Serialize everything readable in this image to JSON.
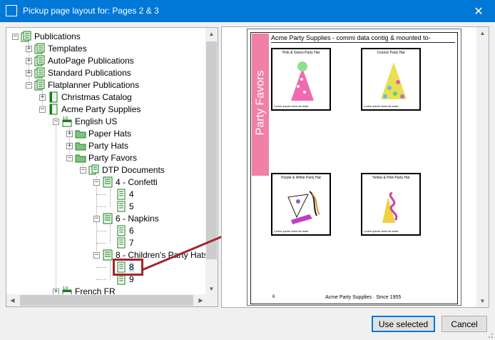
{
  "window": {
    "title": "Pickup page layout for: Pages 2 & 3",
    "close_glyph": "✕"
  },
  "tree": {
    "nodes": [
      {
        "label": "Publications",
        "level": 0,
        "expander": "−",
        "icon": "publications-icon"
      },
      {
        "label": "Templates",
        "level": 1,
        "expander": "+",
        "icon": "publications-icon"
      },
      {
        "label": "AutoPage Publications",
        "level": 1,
        "expander": "+",
        "icon": "publications-icon"
      },
      {
        "label": "Standard Publications",
        "level": 1,
        "expander": "+",
        "icon": "publications-icon"
      },
      {
        "label": "Flatplanner Publications",
        "level": 1,
        "expander": "−",
        "icon": "publications-icon"
      },
      {
        "label": "Christmas Catalog",
        "level": 2,
        "expander": "+",
        "icon": "publication-icon"
      },
      {
        "label": "Acme Party Supplies",
        "level": 2,
        "expander": "−",
        "icon": "publication-icon"
      },
      {
        "label": "English US",
        "level": 3,
        "expander": "−",
        "icon": "edition-icon"
      },
      {
        "label": "Paper Hats",
        "level": 4,
        "expander": "+",
        "icon": "folder-icon"
      },
      {
        "label": "Party Hats",
        "level": 4,
        "expander": "+",
        "icon": "folder-icon"
      },
      {
        "label": "Party Favors",
        "level": 4,
        "expander": "−",
        "icon": "folder-icon"
      },
      {
        "label": "DTP Documents",
        "level": 5,
        "expander": "−",
        "icon": "documents-icon"
      },
      {
        "label": "4 - Confetti",
        "level": 6,
        "expander": "−",
        "icon": "document-icon"
      },
      {
        "label": "4",
        "level": 7,
        "expander": "",
        "icon": "page-icon"
      },
      {
        "label": "5",
        "level": 7,
        "expander": "",
        "icon": "page-icon"
      },
      {
        "label": "6 - Napkins",
        "level": 6,
        "expander": "−",
        "icon": "document-icon"
      },
      {
        "label": "6",
        "level": 7,
        "expander": "",
        "icon": "page-icon"
      },
      {
        "label": "7",
        "level": 7,
        "expander": "",
        "icon": "page-icon"
      },
      {
        "label": "8 - Children's Party Hats",
        "level": 6,
        "expander": "−",
        "icon": "document-icon"
      },
      {
        "label": "8",
        "level": 7,
        "expander": "",
        "icon": "page-icon",
        "selected": true
      },
      {
        "label": "9",
        "level": 7,
        "expander": "",
        "icon": "page-icon"
      },
      {
        "label": "French FR",
        "level": 3,
        "expander": "+",
        "icon": "edition-icon"
      }
    ]
  },
  "preview": {
    "band_label": "Party Favors",
    "header_text": "Acme Party Supplies - commi data contig & mounted to-",
    "cards": [
      {
        "title": "Pink & Green Party Hat",
        "footer": "Lorem ipsum dolor sit amet"
      },
      {
        "title": "Cosmic Party Hat",
        "footer": "Lorem ipsum dolor sit amet"
      },
      {
        "title": "Purple & White Party Hat",
        "footer": "Lorem ipsum dolor sit amet"
      },
      {
        "title": "Yellow & Pink Party Hat",
        "footer": "Lorem ipsum dolor sit amet"
      }
    ],
    "footer_page": "6",
    "footer_text": "Acme Party Supplies · Since 1955"
  },
  "buttons": {
    "use_selected": "Use selected",
    "cancel": "Cancel"
  },
  "colors": {
    "titlebar": "#0078d7",
    "band": "#f080a8",
    "highlight": "#a0262f"
  }
}
